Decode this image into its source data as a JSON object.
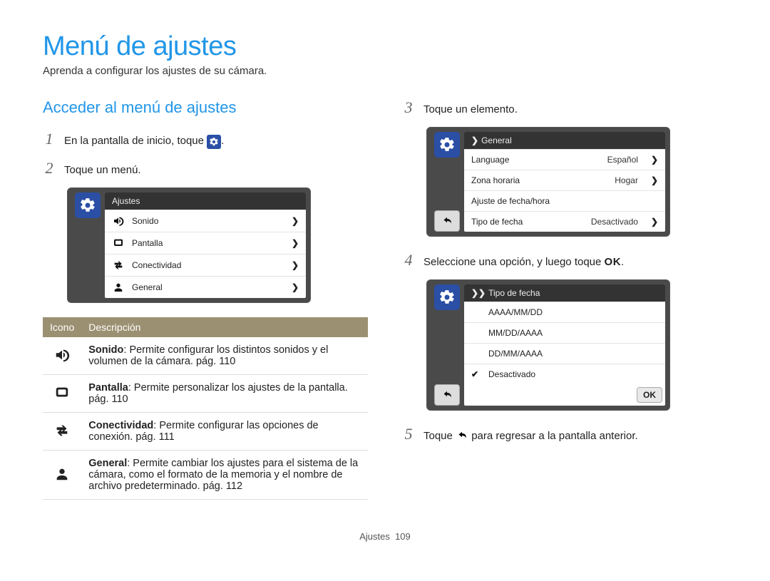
{
  "page_title": "Menú de ajustes",
  "intro": "Aprenda a configurar los ajustes de su cámara.",
  "subheading": "Acceder al menú de ajustes",
  "steps": {
    "1a": "En la pantalla de inicio, toque ",
    "1b": ".",
    "2": "Toque un menú.",
    "3": "Toque un elemento.",
    "4a": "Seleccione una opción, y luego toque ",
    "4b": ".",
    "5a": "Toque ",
    "5b": " para regresar a la pantalla anterior."
  },
  "ok_label": "OK",
  "shot1": {
    "header": "Ajustes",
    "rows": [
      {
        "label": "Sonido"
      },
      {
        "label": "Pantalla"
      },
      {
        "label": "Conectividad"
      },
      {
        "label": "General"
      }
    ]
  },
  "shot2": {
    "header": "General",
    "rows": [
      {
        "label": "Language",
        "value": "Español",
        "chev": true
      },
      {
        "label": "Zona horaria",
        "value": "Hogar",
        "chev": true
      },
      {
        "label": "Ajuste de fecha/hora",
        "value": "",
        "chev": false
      },
      {
        "label": "Tipo de fecha",
        "value": "Desactivado",
        "chev": true
      }
    ]
  },
  "shot3": {
    "header": "Tipo de fecha",
    "rows": [
      {
        "label": "AAAA/MM/DD",
        "checked": false
      },
      {
        "label": "MM/DD/AAAA",
        "checked": false
      },
      {
        "label": "DD/MM/AAAA",
        "checked": false
      },
      {
        "label": "Desactivado",
        "checked": true
      }
    ],
    "ok": "OK"
  },
  "table": {
    "headers": {
      "icon": "Icono",
      "desc": "Descripción"
    },
    "rows": [
      {
        "term": "Sonido",
        "text": ": Permite configurar los distintos sonidos y el volumen de la cámara. pág. 110"
      },
      {
        "term": "Pantalla",
        "text": ": Permite personalizar los ajustes de la pantalla. pág. 110"
      },
      {
        "term": "Conectividad",
        "text": ": Permite configurar las opciones de conexión. pág. 111"
      },
      {
        "term": "General",
        "text": ": Permite cambiar los ajustes para el sistema de la cámara, como el formato de la memoria y el nombre de archivo predeterminado. pág. 112"
      }
    ]
  },
  "footer": {
    "section": "Ajustes",
    "page": "109"
  }
}
